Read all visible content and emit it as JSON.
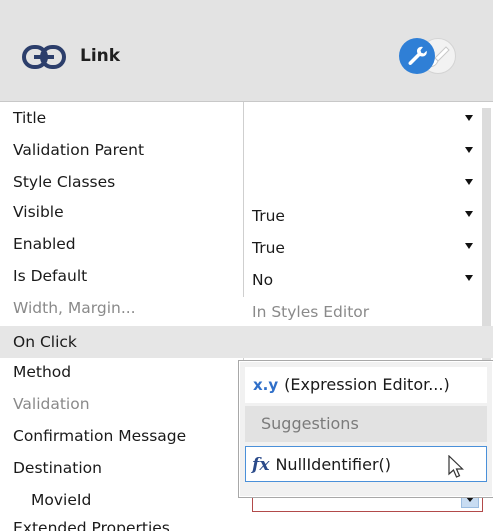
{
  "header": {
    "title": "Link",
    "icons": [
      "link-icon",
      "wrench-icon",
      "paint-brush-icon"
    ]
  },
  "properties": [
    {
      "label": "Title",
      "value": "",
      "dropdown": true,
      "disabled": false
    },
    {
      "label": "Validation Parent",
      "value": "",
      "dropdown": true,
      "disabled": false
    },
    {
      "label": "Style Classes",
      "value": "",
      "dropdown": true,
      "disabled": false
    },
    {
      "label": "Visible",
      "value": "True",
      "dropdown": true,
      "disabled": false
    },
    {
      "label": "Enabled",
      "value": "True",
      "dropdown": true,
      "disabled": false
    },
    {
      "label": "Is Default",
      "value": "No",
      "dropdown": true,
      "disabled": false
    },
    {
      "label": "Width, Margin...",
      "value": "In Styles Editor",
      "dropdown": false,
      "disabled": true
    }
  ],
  "section": {
    "label": "On Click"
  },
  "onclick_properties": [
    {
      "label": "Method",
      "disabled": false
    },
    {
      "label": "Validation",
      "disabled": true
    },
    {
      "label": "Confirmation Message",
      "disabled": false
    },
    {
      "label": "Destination",
      "disabled": false
    }
  ],
  "movie_row": {
    "label": "MovieId",
    "value": ""
  },
  "next_section": {
    "label": "Extended Properties"
  },
  "popup": {
    "expression_prefix": "x.y",
    "expression_label": "(Expression Editor...)",
    "suggestions_label": "Suggestions",
    "fx_prefix": "fx",
    "null_identifier": "NullIdentifier()"
  },
  "colors": {
    "header_bg": "#e3e3e3",
    "accent_blue": "#2f7fd6",
    "section_bg": "#e6e6e6",
    "error_border": "#b24a4a"
  }
}
